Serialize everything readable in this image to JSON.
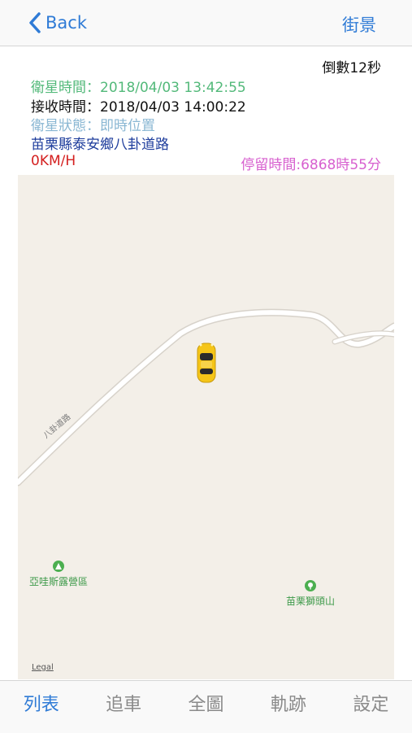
{
  "nav": {
    "back_label": "Back",
    "street_label": "街景"
  },
  "info": {
    "countdown": "倒數12秒",
    "satellite_time": "衛星時間：2018/04/03 13:42:55",
    "receive_time": "接收時間：2018/04/03 14:00:22",
    "satellite_status": "衛星狀態：即時位置",
    "address": "苗栗縣泰安鄉八卦道路",
    "speed": "0KM/H",
    "stay_time": "停留時間:6868時55分"
  },
  "map": {
    "road_name": "八卦道路",
    "poi_1": "亞哇斯露營區",
    "poi_2": "苗栗獅頭山",
    "legal": "Legal"
  },
  "tabs": [
    {
      "label": "列表",
      "active": true
    },
    {
      "label": "追車",
      "active": false
    },
    {
      "label": "全圖",
      "active": false
    },
    {
      "label": "軌跡",
      "active": false
    },
    {
      "label": "設定",
      "active": false
    }
  ],
  "colors": {
    "accent": "#2f7bd6",
    "satellite_time": "#53b97a",
    "satellite_status": "#8ab7d3",
    "address": "#1e3d9c",
    "speed": "#d42020",
    "stay_time": "#d75fcf",
    "map_background": "#f3efe8",
    "car": "#f5c518"
  }
}
